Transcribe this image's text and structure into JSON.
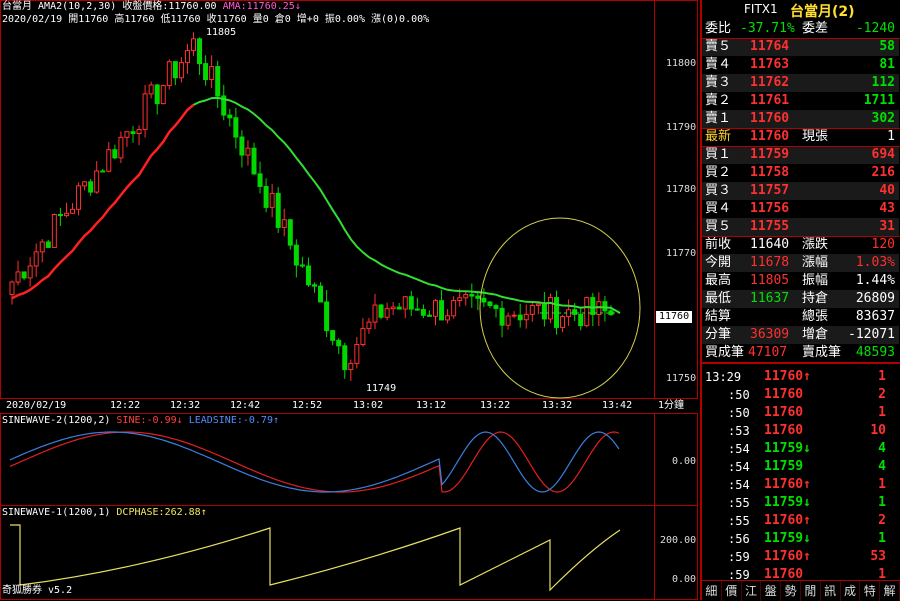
{
  "chart_header": {
    "label": "台當月",
    "ama": "AMA2(10,2,30)",
    "close_label": "收盤價格:11760.00",
    "ama_value": "AMA:11760.25",
    "down_arrow": "↓",
    "ohlc": "2020/02/19 開11760 高11760 低11760 收11760 量0 倉0 增+0 振0.00% 漲(0)0.00%"
  },
  "price_chart": {
    "y_ticks": [
      "11800",
      "11790",
      "11780",
      "11770",
      "11750"
    ],
    "current_tag": "11760",
    "high_label": "11805",
    "low_label": "11749",
    "x_ticks": [
      "2020/02/19",
      "12:22",
      "12:32",
      "12:42",
      "12:52",
      "13:02",
      "13:12",
      "13:22",
      "13:32",
      "13:42"
    ],
    "period": "1分鐘"
  },
  "sine2": {
    "label": "SINEWAVE-2(1200,2)",
    "sine": "SINE:-0.99",
    "sine_arrow": "↓",
    "leadsine": "LEADSINE:-0.79",
    "lead_arrow": "↑",
    "y_tick": "0.00"
  },
  "sine1": {
    "label": "SINEWAVE-1(1200,1)",
    "dcphase": "DCPHASE:262.88",
    "arrow": "↑",
    "y_tick_top": "200.00",
    "y_tick_bottom": "0.00",
    "brand": "奇狐勝券 v5.2"
  },
  "quote": {
    "code": "FITX1",
    "name": "台當月(2)",
    "weibi_label": "委比",
    "weibi_value": "-37.71%",
    "weicha_label": "委差",
    "weicha_value": "-1240",
    "asks": [
      {
        "label": "賣５",
        "price": "11764",
        "vol": "58"
      },
      {
        "label": "賣４",
        "price": "11763",
        "vol": "81"
      },
      {
        "label": "賣３",
        "price": "11762",
        "vol": "112"
      },
      {
        "label": "賣２",
        "price": "11761",
        "vol": "1711"
      },
      {
        "label": "賣１",
        "price": "11760",
        "vol": "302"
      }
    ],
    "last_label": "最新",
    "last_price": "11760",
    "cur_vol_label": "現張",
    "cur_vol": "1",
    "bids": [
      {
        "label": "買１",
        "price": "11759",
        "vol": "694"
      },
      {
        "label": "買２",
        "price": "11758",
        "vol": "216"
      },
      {
        "label": "買３",
        "price": "11757",
        "vol": "40"
      },
      {
        "label": "買４",
        "price": "11756",
        "vol": "43"
      },
      {
        "label": "買５",
        "price": "11755",
        "vol": "31"
      }
    ],
    "stats": [
      {
        "l1": "前收",
        "v1": "11640",
        "l2": "漲跌",
        "v2": "120"
      },
      {
        "l1": "今開",
        "v1": "11678",
        "l2": "漲幅",
        "v2": "1.03%"
      },
      {
        "l1": "最高",
        "v1": "11805",
        "l2": "振幅",
        "v2": "1.44%"
      },
      {
        "l1": "最低",
        "v1": "11637",
        "l2": "持倉",
        "v2": "26809"
      },
      {
        "l1": "結算",
        "v1": "",
        "l2": "總張",
        "v2": "83637"
      },
      {
        "l1": "分筆",
        "v1": "36309",
        "l2": "增倉",
        "v2": "-12071"
      }
    ],
    "buy_count_label": "買成筆",
    "buy_count": "47107",
    "sell_count_label": "賣成筆",
    "sell_count": "48593"
  },
  "ticks": [
    {
      "time": "13:29",
      "price": "11760",
      "arrow": "↑",
      "vol": "1"
    },
    {
      "time": ":50",
      "price": "11760",
      "arrow": "",
      "vol": "2"
    },
    {
      "time": ":50",
      "price": "11760",
      "arrow": "",
      "vol": "1"
    },
    {
      "time": ":53",
      "price": "11760",
      "arrow": "",
      "vol": "10"
    },
    {
      "time": ":54",
      "price": "11759",
      "arrow": "↓",
      "vol": "4"
    },
    {
      "time": ":54",
      "price": "11759",
      "arrow": "",
      "vol": "4"
    },
    {
      "time": ":54",
      "price": "11760",
      "arrow": "↑",
      "vol": "1"
    },
    {
      "time": ":55",
      "price": "11759",
      "arrow": "↓",
      "vol": "1"
    },
    {
      "time": ":55",
      "price": "11760",
      "arrow": "↑",
      "vol": "2"
    },
    {
      "time": ":56",
      "price": "11759",
      "arrow": "↓",
      "vol": "1"
    },
    {
      "time": ":59",
      "price": "11760",
      "arrow": "↑",
      "vol": "53"
    },
    {
      "time": ":59",
      "price": "11760",
      "arrow": "",
      "vol": "1"
    }
  ],
  "bottom_tabs": [
    "細",
    "價",
    "江",
    "盤",
    "勢",
    "閒",
    "訊",
    "成",
    "特",
    "解"
  ],
  "colors": {
    "up": "#ff3030",
    "down": "#00d800",
    "ama": "#33dd33",
    "sine": "#e02020",
    "lead": "#3b7fe0",
    "dc": "#e8e060",
    "circle": "#d8d050",
    "frame": "#b00000"
  }
}
